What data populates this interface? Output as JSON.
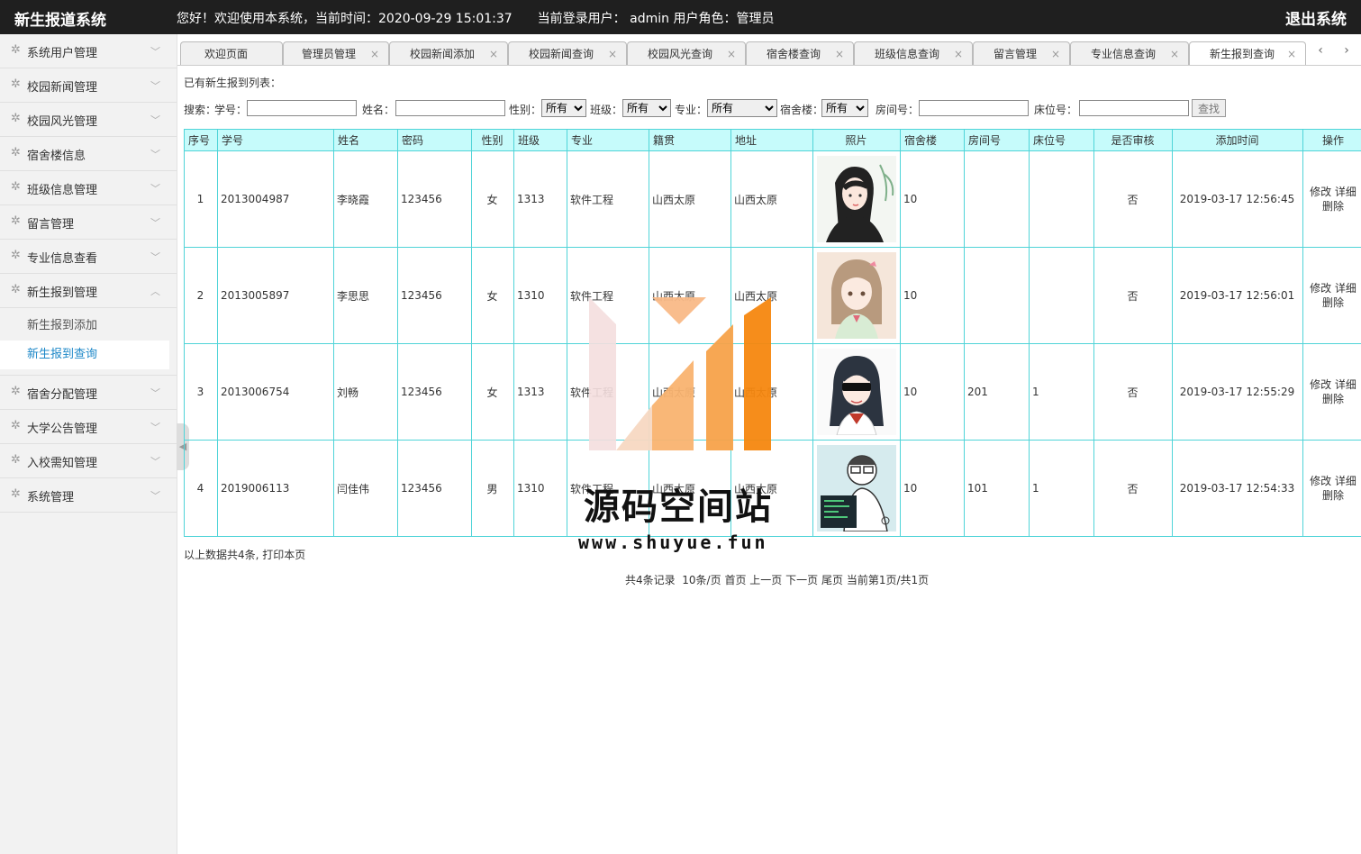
{
  "header": {
    "app_title": "新生报道系统",
    "welcome": "您好！欢迎使用本系统，当前时间：2020-09-29 15:01:37　　当前登录用户：  admin  用户角色：管理员",
    "logout": "退出系统"
  },
  "sidebar": {
    "items": [
      {
        "label": "系统用户管理"
      },
      {
        "label": "校园新闻管理"
      },
      {
        "label": "校园风光管理"
      },
      {
        "label": "宿舍楼信息"
      },
      {
        "label": "班级信息管理"
      },
      {
        "label": "留言管理"
      },
      {
        "label": "专业信息查看"
      },
      {
        "label": "新生报到管理"
      },
      {
        "label": "宿舍分配管理"
      },
      {
        "label": "大学公告管理"
      },
      {
        "label": "入校需知管理"
      },
      {
        "label": "系统管理"
      }
    ],
    "sub_items": [
      {
        "label": "新生报到添加"
      },
      {
        "label": "新生报到查询"
      }
    ]
  },
  "tabs": [
    {
      "label": "欢迎页面"
    },
    {
      "label": "管理员管理"
    },
    {
      "label": "校园新闻添加"
    },
    {
      "label": "校园新闻查询"
    },
    {
      "label": "校园风光查询"
    },
    {
      "label": "宿舍楼查询"
    },
    {
      "label": "班级信息查询"
    },
    {
      "label": "留言管理"
    },
    {
      "label": "专业信息查询"
    },
    {
      "label": "新生报到查询"
    }
  ],
  "list_title": "已有新生报到列表：",
  "search": {
    "prefix": "搜索：",
    "student_no_label": "学号：",
    "name_label": "姓名：",
    "gender_label": "性别：",
    "gender_value": "所有",
    "class_label": "班级：",
    "class_value": "所有",
    "major_label": "专业：",
    "major_value": "所有",
    "dorm_label": "宿舍楼：",
    "dorm_value": "所有",
    "room_label": "房间号：",
    "bed_label": "床位号：",
    "button": "查找"
  },
  "table": {
    "headers": [
      "序号",
      "学号",
      "姓名",
      "密码",
      "性别",
      "班级",
      "专业",
      "籍贯",
      "地址",
      "照片",
      "宿舍楼",
      "房间号",
      "床位号",
      "是否审核",
      "添加时间",
      "操作"
    ],
    "rows": [
      {
        "no": "1",
        "student_no": "2013004987",
        "name": "李晓霞",
        "password": "123456",
        "gender": "女",
        "class": "1313",
        "major": "软件工程",
        "native": "山西太原",
        "address": "山西太原",
        "dorm": "10",
        "room": "",
        "bed": "",
        "audited": "否",
        "time": "2019-03-17 12:56:45"
      },
      {
        "no": "2",
        "student_no": "2013005897",
        "name": "李思思",
        "password": "123456",
        "gender": "女",
        "class": "1310",
        "major": "软件工程",
        "native": "山西太原",
        "address": "山西太原",
        "dorm": "10",
        "room": "",
        "bed": "",
        "audited": "否",
        "time": "2019-03-17 12:56:01"
      },
      {
        "no": "3",
        "student_no": "2013006754",
        "name": "刘畅",
        "password": "123456",
        "gender": "女",
        "class": "1313",
        "major": "软件工程",
        "native": "山西太原",
        "address": "山西太原",
        "dorm": "10",
        "room": "201",
        "bed": "1",
        "audited": "否",
        "time": "2019-03-17 12:55:29"
      },
      {
        "no": "4",
        "student_no": "2019006113",
        "name": "闫佳伟",
        "password": "123456",
        "gender": "男",
        "class": "1310",
        "major": "软件工程",
        "native": "山西太原",
        "address": "山西太原",
        "dorm": "10",
        "room": "101",
        "bed": "1",
        "audited": "否",
        "time": "2019-03-17 12:54:33"
      }
    ],
    "op_edit": "修改",
    "op_detail": "详细",
    "op_delete": "删除"
  },
  "summary": "以上数据共4条, 打印本页",
  "pager": {
    "records": "共4条记录",
    "per_page": "10条/页",
    "first": "首页",
    "prev": "上一页",
    "next": "下一页",
    "last": "尾页",
    "current": "当前第1页/共1页"
  },
  "watermark": {
    "text": "源码空间站",
    "url": "www.shuyue.fun"
  },
  "colors": {
    "topbar": "#1f1f1f",
    "table_header": "#c6fbfb",
    "table_border": "#4fd4d8",
    "active_link": "#1e88c8"
  }
}
